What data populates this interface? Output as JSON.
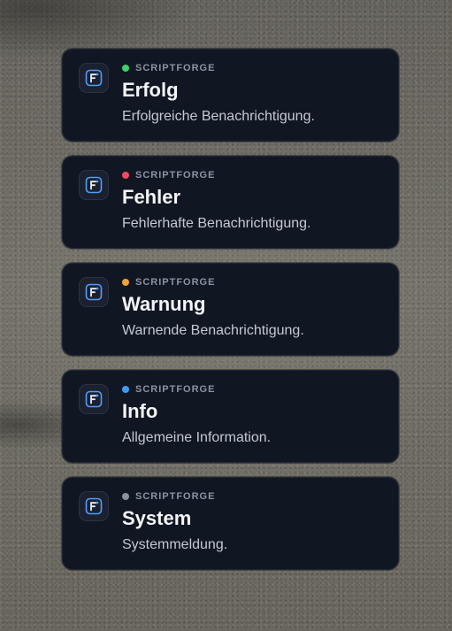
{
  "notifications": [
    {
      "brand": "SCRIPTFORGE",
      "title": "Erfolg",
      "message": "Erfolgreiche Benachrichtigung.",
      "dot_color": "#3ecf6e",
      "type": "success"
    },
    {
      "brand": "SCRIPTFORGE",
      "title": "Fehler",
      "message": "Fehlerhafte Benachrichtigung.",
      "dot_color": "#ef4b5f",
      "type": "error"
    },
    {
      "brand": "SCRIPTFORGE",
      "title": "Warnung",
      "message": "Warnende Benachrichtigung.",
      "dot_color": "#f2a23a",
      "type": "warning"
    },
    {
      "brand": "SCRIPTFORGE",
      "title": "Info",
      "message": "Allgemeine Information.",
      "dot_color": "#3b9cf5",
      "type": "info"
    },
    {
      "brand": "SCRIPTFORGE",
      "title": "System",
      "message": "Systemmeldung.",
      "dot_color": "#8a909c",
      "type": "system"
    }
  ],
  "logo": {
    "icon": "scriptforge-logo-icon",
    "color": "#4f9ef8"
  }
}
